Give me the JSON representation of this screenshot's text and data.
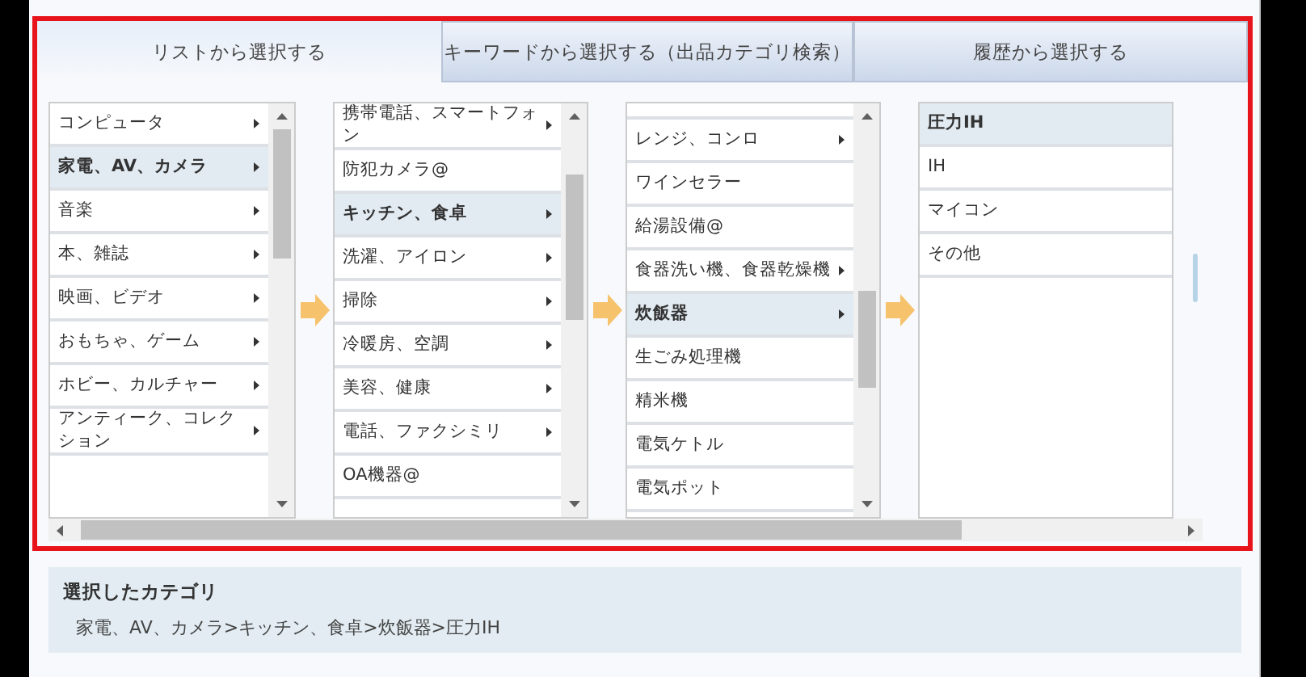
{
  "tabs": [
    {
      "label": "リストから選択する",
      "selected": true
    },
    {
      "label": "キーワードから選択する（出品カテゴリ検索）",
      "selected": false
    },
    {
      "label": "履歴から選択する",
      "selected": false
    }
  ],
  "columns": [
    {
      "kind": "scrolling",
      "lead": false,
      "items": [
        {
          "label": "コンピュータ",
          "selected": false,
          "has_children": true
        },
        {
          "label": "家電、AV、カメラ",
          "selected": true,
          "has_children": true
        },
        {
          "label": "音楽",
          "selected": false,
          "has_children": true
        },
        {
          "label": "本、雑誌",
          "selected": false,
          "has_children": true
        },
        {
          "label": "映画、ビデオ",
          "selected": false,
          "has_children": true
        },
        {
          "label": "おもちゃ、ゲーム",
          "selected": false,
          "has_children": true
        },
        {
          "label": "ホビー、カルチャー",
          "selected": false,
          "has_children": true
        },
        {
          "label": "アンティーク、コレクション",
          "selected": false,
          "has_children": true
        }
      ]
    },
    {
      "kind": "scrolling",
      "lead": false,
      "items": [
        {
          "label": "携帯電話、スマートフォン",
          "selected": false,
          "has_children": true
        },
        {
          "label": "防犯カメラ@",
          "selected": false,
          "has_children": false
        },
        {
          "label": "キッチン、食卓",
          "selected": true,
          "has_children": true
        },
        {
          "label": "洗濯、アイロン",
          "selected": false,
          "has_children": true
        },
        {
          "label": "掃除",
          "selected": false,
          "has_children": true
        },
        {
          "label": "冷暖房、空調",
          "selected": false,
          "has_children": true
        },
        {
          "label": "美容、健康",
          "selected": false,
          "has_children": true
        },
        {
          "label": "電話、ファクシミリ",
          "selected": false,
          "has_children": true
        },
        {
          "label": "OA機器@",
          "selected": false,
          "has_children": false
        }
      ]
    },
    {
      "kind": "scrolling",
      "lead": true,
      "items": [
        {
          "label": "レンジ、コンロ",
          "selected": false,
          "has_children": true
        },
        {
          "label": "ワインセラー",
          "selected": false,
          "has_children": false
        },
        {
          "label": "給湯設備@",
          "selected": false,
          "has_children": false
        },
        {
          "label": "食器洗い機、食器乾燥機",
          "selected": false,
          "has_children": true
        },
        {
          "label": "炊飯器",
          "selected": true,
          "has_children": true
        },
        {
          "label": "生ごみ処理機",
          "selected": false,
          "has_children": false
        },
        {
          "label": "精米機",
          "selected": false,
          "has_children": false
        },
        {
          "label": "電気ケトル",
          "selected": false,
          "has_children": false
        },
        {
          "label": "電気ポット",
          "selected": false,
          "has_children": false
        }
      ]
    },
    {
      "kind": "plain",
      "lead": false,
      "items": [
        {
          "label": "圧力IH",
          "selected": true,
          "has_children": false
        },
        {
          "label": "IH",
          "selected": false,
          "has_children": false
        },
        {
          "label": "マイコン",
          "selected": false,
          "has_children": false
        },
        {
          "label": "その他",
          "selected": false,
          "has_children": false
        }
      ]
    }
  ],
  "selection": {
    "title": "選択したカテゴリ",
    "path": "家電、AV、カメラ>キッチン、食卓>炊飯器>圧力IH"
  }
}
